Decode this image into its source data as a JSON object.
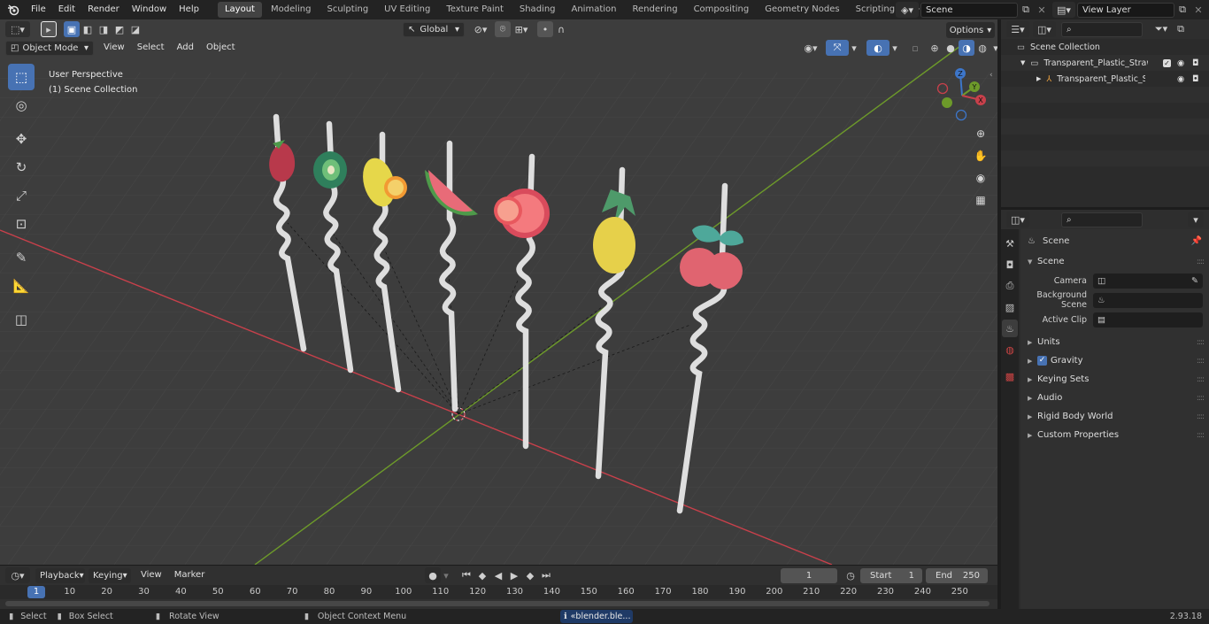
{
  "menu": {
    "items": [
      "File",
      "Edit",
      "Render",
      "Window",
      "Help"
    ]
  },
  "workspaces": {
    "tabs": [
      "Layout",
      "Modeling",
      "Sculpting",
      "UV Editing",
      "Texture Paint",
      "Shading",
      "Animation",
      "Rendering",
      "Compositing",
      "Geometry Nodes",
      "Scripting"
    ],
    "active": "Layout",
    "add_label": "+"
  },
  "scene_selector": {
    "value": "Scene"
  },
  "view_layer": {
    "value": "View Layer"
  },
  "header": {
    "transform_orientation": "Global",
    "options_label": "Options"
  },
  "viewport": {
    "mode": "Object Mode",
    "menus": [
      "View",
      "Select",
      "Add",
      "Object"
    ],
    "info_line1": "User Perspective",
    "info_line2": "(1) Scene Collection",
    "gizmo": {
      "z": "Z",
      "y": "Y",
      "x": "X"
    }
  },
  "colors": {
    "accent": "#4772b3",
    "x_axis": "#c8404b",
    "y_axis": "#6d9a2a",
    "z_axis": "#3d76c9"
  },
  "timeline": {
    "menus": [
      "Playback",
      "Keying",
      "View",
      "Marker"
    ],
    "current_frame": "1",
    "start_label": "Start",
    "start_value": "1",
    "end_label": "End",
    "end_value": "250",
    "ticks": [
      "1",
      "10",
      "20",
      "30",
      "40",
      "50",
      "60",
      "70",
      "80",
      "90",
      "100",
      "110",
      "120",
      "130",
      "140",
      "150",
      "160",
      "170",
      "180",
      "190",
      "200",
      "210",
      "220",
      "230",
      "240",
      "250"
    ]
  },
  "statusbar": {
    "select": "Select",
    "box_select": "Box Select",
    "rotate_view": "Rotate View",
    "context_menu": "Object Context Menu",
    "notification": "«blender.ble...",
    "version": "2.93.18"
  },
  "outliner": {
    "root": "Scene Collection",
    "items": [
      {
        "label": "Transparent_Plastic_Straws_w"
      },
      {
        "label": "Transparent_Plastic_Stra"
      }
    ]
  },
  "properties": {
    "context": "Scene",
    "panel_title": "Scene",
    "fields": [
      {
        "label": "Camera",
        "value": ""
      },
      {
        "label": "Background Scene",
        "value": ""
      },
      {
        "label": "Active Clip",
        "value": ""
      }
    ],
    "subpanels": [
      "Units",
      "Gravity",
      "Keying Sets",
      "Audio",
      "Rigid Body World",
      "Custom Properties"
    ],
    "gravity_enabled": true
  }
}
